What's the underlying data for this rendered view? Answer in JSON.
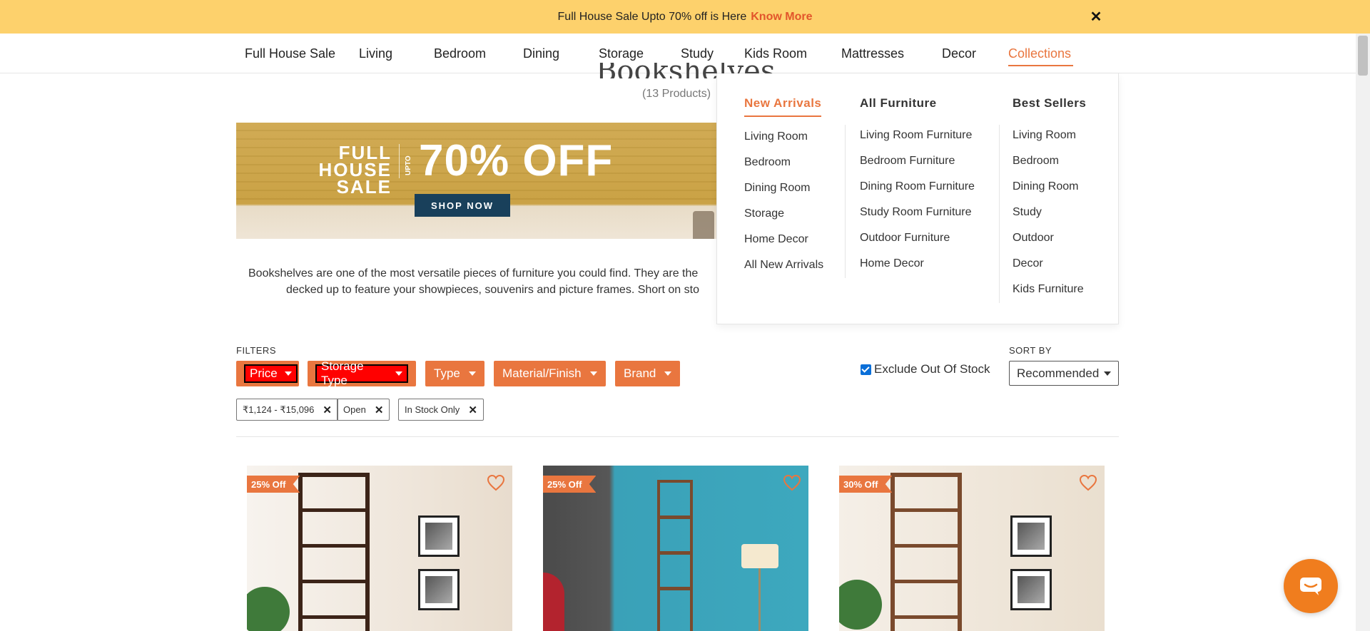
{
  "promo": {
    "text": "Full House Sale Upto 70% off is Here",
    "link": "Know More",
    "close_icon": "close-icon"
  },
  "nav": {
    "items": [
      "Full House Sale",
      "Living",
      "Bedroom",
      "Dining",
      "Storage",
      "Study",
      "Kids Room",
      "Mattresses",
      "Decor",
      "Collections"
    ],
    "active": "Collections"
  },
  "page": {
    "title": "Bookshelves",
    "count": "(13 Products)"
  },
  "banner": {
    "line1": "FULL HOUSE",
    "line2": "SALE",
    "upto": "UPTO",
    "headline": "70% OFF",
    "cta": "SHOP NOW"
  },
  "description": {
    "line1": "Bookshelves are one of the most versatile pieces of furniture you could find. They are the",
    "line2": "decked up to feature your showpieces, souvenirs and picture frames. Short on sto"
  },
  "mega_menu": {
    "columns": [
      {
        "title": "New Arrivals",
        "items": [
          "Living Room",
          "Bedroom",
          "Dining Room",
          "Storage",
          "Home Decor",
          "All New Arrivals"
        ]
      },
      {
        "title": "All Furniture",
        "items": [
          "Living Room Furniture",
          "Bedroom Furniture",
          "Dining Room Furniture",
          "Study Room Furniture",
          "Outdoor Furniture",
          "Home Decor"
        ]
      },
      {
        "title": "Best Sellers",
        "items": [
          "Living Room",
          "Bedroom",
          "Dining Room",
          "Study",
          "Outdoor",
          "Decor",
          "Kids Furniture"
        ]
      }
    ]
  },
  "filters": {
    "label": "FILTERS",
    "buttons": [
      "Price",
      "Storage Type",
      "Type",
      "Material/Finish",
      "Brand"
    ],
    "exclude_out_of_stock": "Exclude Out Of Stock",
    "exclude_checked": true,
    "applied": [
      "₹1,124 - ₹15,096",
      "Open",
      "In Stock Only"
    ]
  },
  "sort": {
    "label": "SORT BY",
    "value": "Recommended"
  },
  "products": [
    {
      "badge": "25% Off"
    },
    {
      "badge": "25% Off"
    },
    {
      "badge": "30% Off"
    }
  ],
  "colors": {
    "accent": "#e9763f",
    "promo_bg": "#fdd16c",
    "link": "#e2552b",
    "chat": "#f07d1e"
  }
}
